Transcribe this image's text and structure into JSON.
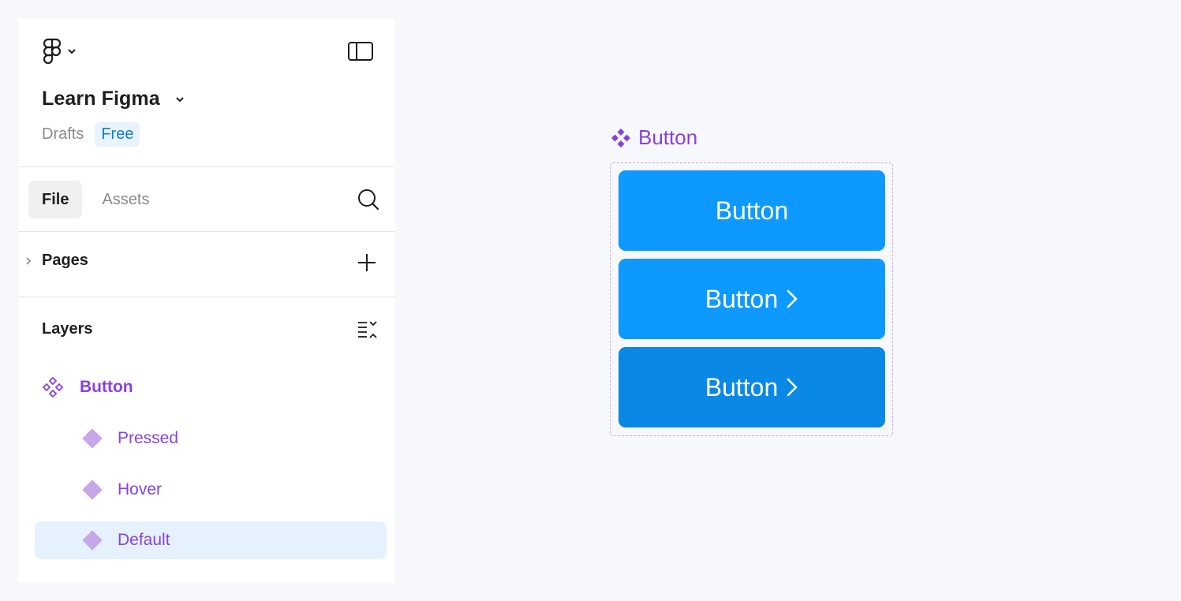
{
  "header": {
    "file_title": "Learn Figma",
    "location": "Drafts",
    "plan_badge": "Free"
  },
  "tabs": [
    {
      "label": "File",
      "active": true
    },
    {
      "label": "Assets",
      "active": false
    }
  ],
  "pages": {
    "label": "Pages"
  },
  "layers": {
    "label": "Layers",
    "items": [
      {
        "label": "Button",
        "type": "component-set",
        "level": 0
      },
      {
        "label": "Pressed",
        "type": "variant",
        "level": 1
      },
      {
        "label": "Hover",
        "type": "variant",
        "level": 1
      },
      {
        "label": "Default",
        "type": "variant",
        "level": 1,
        "selected": true
      }
    ]
  },
  "canvas": {
    "component_label": "Button",
    "variants": [
      {
        "label": "Button",
        "has_chevron": false,
        "color": "#0d99ff"
      },
      {
        "label": "Button",
        "has_chevron": true,
        "color": "#0d99ff"
      },
      {
        "label": "Button",
        "has_chevron": true,
        "color": "#0a88e6"
      }
    ]
  },
  "colors": {
    "component_purple": "#8a40e0",
    "accent_blue": "#0d99ff",
    "selection_bg": "#e5f2fe"
  },
  "icons": [
    "figma-logo-icon",
    "chevron-down-icon",
    "sidebar-toggle-icon",
    "search-icon",
    "chevron-right-icon",
    "plus-icon",
    "layers-collapse-icon",
    "component-set-icon",
    "variant-icon"
  ]
}
